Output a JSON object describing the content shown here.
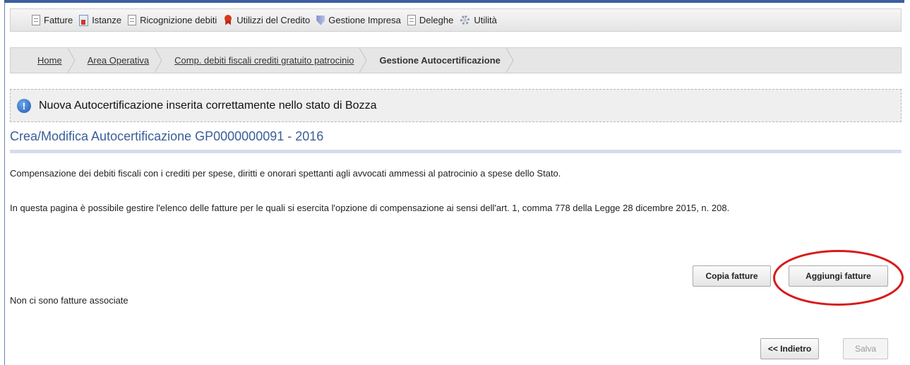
{
  "top_menu": [
    {
      "label": "Fatture",
      "icon": "document-icon"
    },
    {
      "label": "Istanze",
      "icon": "istanze-icon"
    },
    {
      "label": "Ricognizione debiti",
      "icon": "document-icon"
    },
    {
      "label": "Utilizzi del Credito",
      "icon": "ribbon-icon"
    },
    {
      "label": "Gestione Impresa",
      "icon": "shield-icon"
    },
    {
      "label": "Deleghe",
      "icon": "document-icon"
    },
    {
      "label": "Utilità",
      "icon": "gear-icon"
    }
  ],
  "breadcrumb": {
    "items": [
      "Home",
      "Area Operativa",
      "Comp. debiti fiscali crediti gratuito patrocinio"
    ],
    "current": "Gestione Autocertificazione"
  },
  "notice": {
    "icon": "info-icon",
    "text": "Nuova Autocertificazione inserita correttamente nello stato di Bozza"
  },
  "page_title": "Crea/Modifica Autocertificazione GP0000000091 - 2016",
  "description": "Compensazione dei debiti fiscali con i crediti per spese, diritti e onorari spettanti agli avvocati ammessi al patrocinio a spese dello Stato.",
  "instructions": "In questa pagina è possibile gestire l'elenco delle fatture per le quali si esercita l'opzione di compensazione ai sensi dell'art. 1, comma 778 della Legge 28 dicembre 2015, n. 208.",
  "actions": {
    "copy_label": "Copia fatture",
    "add_label": "Aggiungi fatture"
  },
  "empty_message": "Non ci sono fatture associate",
  "footer": {
    "back_label": "<< Indietro",
    "save_label": "Salva"
  },
  "colors": {
    "accent": "#3a5fa0",
    "title": "#3a5e98",
    "highlight": "#d91a1a"
  }
}
